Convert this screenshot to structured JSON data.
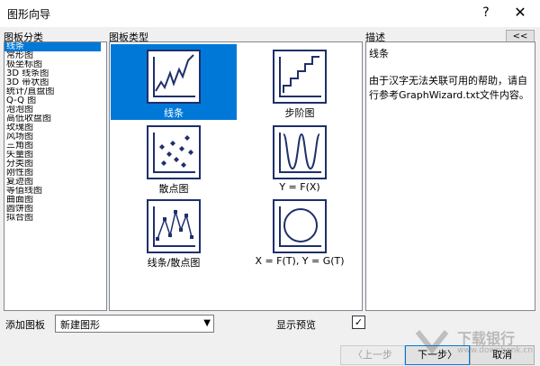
{
  "window": {
    "title": "图形向导",
    "help_label": "?",
    "close_label": "✕"
  },
  "left_panel": {
    "header": "图板分类",
    "items": [
      {
        "label": "线条",
        "selected": true
      },
      {
        "label": "常形图"
      },
      {
        "label": "极坐标图"
      },
      {
        "label": "3D 线条图"
      },
      {
        "label": "3D 带状图"
      },
      {
        "label": "统计/直盘图"
      },
      {
        "label": "Q-Q 图"
      },
      {
        "label": "泡泡图"
      },
      {
        "label": "高低收盘图"
      },
      {
        "label": "玫瑰图"
      },
      {
        "label": "风场图"
      },
      {
        "label": "三角图"
      },
      {
        "label": "矢量图"
      },
      {
        "label": "分类图"
      },
      {
        "label": "刚性图"
      },
      {
        "label": "复迹图"
      },
      {
        "label": "等值线图"
      },
      {
        "label": "曲面图"
      },
      {
        "label": "圆饼图"
      },
      {
        "label": "拟合图"
      }
    ]
  },
  "middle_panel": {
    "header": "图板类型",
    "types": [
      {
        "label": "线条",
        "icon": "line-chart-icon",
        "selected": true
      },
      {
        "label": "步阶图",
        "icon": "step-chart-icon"
      },
      {
        "label": "散点图",
        "icon": "scatter-chart-icon"
      },
      {
        "label": "Y = F(X)",
        "icon": "function-chart-icon"
      },
      {
        "label": "线条/散点图",
        "icon": "line-scatter-chart-icon"
      },
      {
        "label": "X = F(T), Y = G(T)",
        "icon": "parametric-chart-icon"
      }
    ]
  },
  "right_panel": {
    "header": "描述",
    "collapse_label": "<<",
    "title_line": "线条",
    "text_line1": "由于汉字无法关联可用的帮助，请自",
    "text_line2": "行参考GraphWizard.txt文件内容。"
  },
  "bottom": {
    "add_label": "添加图板",
    "add_value": "新建图形",
    "preview_label": "显示预览",
    "preview_checked": true,
    "check_mark": "✓",
    "back_label": "〈上一步",
    "next_label": "下一步〉",
    "cancel_label": "取消"
  },
  "watermark": {
    "text": "下载银行",
    "url": "www.downbank.cn"
  },
  "colors": {
    "selection": "#0078d7",
    "icon_stroke": "#1f2f6b"
  }
}
